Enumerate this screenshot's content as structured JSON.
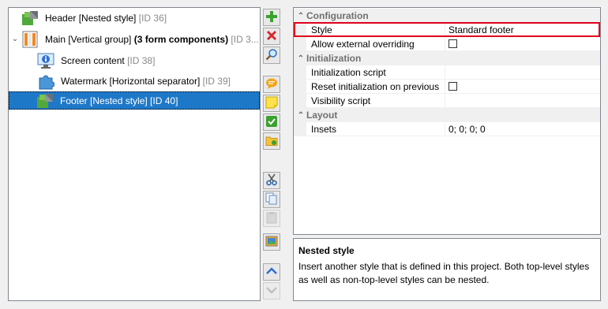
{
  "tree": {
    "items": [
      {
        "label": "Header [Nested style]",
        "id": "[ID 36]"
      },
      {
        "label": "Main [Vertical group]",
        "bold": "(3 form components)",
        "id": "[ID 3..."
      },
      {
        "label": "Screen content",
        "id": "[ID 38]"
      },
      {
        "label": "Watermark [Horizontal separator]",
        "id": "[ID 39]"
      },
      {
        "label": "Footer [Nested style] [ID 40]",
        "id": ""
      }
    ]
  },
  "toolbar": {
    "buttons": [
      "add-icon",
      "delete-icon",
      "search-icon",
      "comment-icon",
      "note-icon",
      "check-icon",
      "folder-icon",
      "cut-icon",
      "copy-icon",
      "paste-icon",
      "image-icon",
      "move-up-icon",
      "move-down-icon"
    ]
  },
  "properties": {
    "categories": [
      {
        "label": "Configuration"
      },
      {
        "label": "Initialization"
      },
      {
        "label": "Layout"
      }
    ],
    "rows": {
      "style": {
        "name": "Style",
        "value": "Standard footer"
      },
      "allow_override": {
        "name": "Allow external overriding"
      },
      "init_script": {
        "name": "Initialization script",
        "value": ""
      },
      "reset_init": {
        "name": "Reset initialization on previous"
      },
      "visibility_script": {
        "name": "Visibility script",
        "value": ""
      },
      "insets": {
        "name": "Insets",
        "value": "0; 0; 0; 0"
      }
    }
  },
  "description": {
    "title": "Nested style",
    "text": "Insert another style that is defined in this project. Both top-level styles as well as non-top-level styles can be nested."
  },
  "colors": {
    "selection": "#1e78c8",
    "highlight_border": "#e0001b"
  }
}
